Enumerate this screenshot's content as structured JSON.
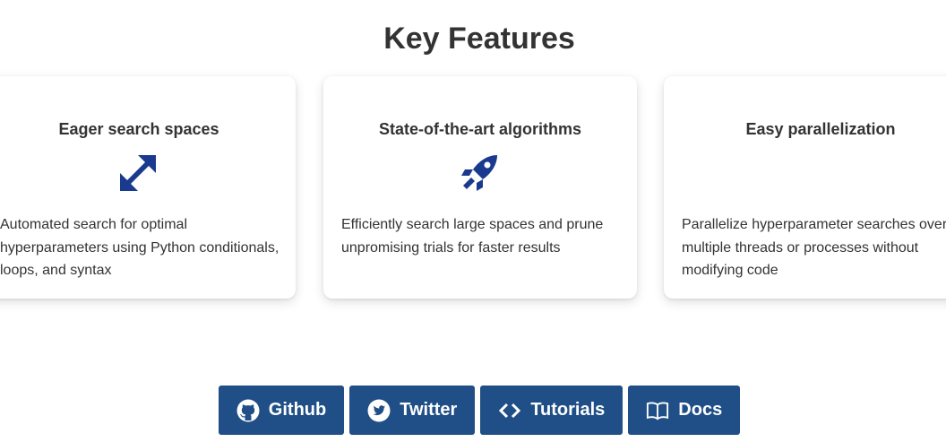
{
  "section": {
    "title": "Key Features"
  },
  "features": [
    {
      "title": "Eager search spaces",
      "icon": "expand-arrows-icon",
      "text": "Automated search for optimal hyperparameters using Python conditionals, loops, and syntax"
    },
    {
      "title": "State-of-the-art algorithms",
      "icon": "rocket-icon",
      "text": "Efficiently search large spaces and prune unpromising trials for faster results"
    },
    {
      "title": "Easy parallelization",
      "icon": "",
      "text": "Parallelize hyperparameter searches over multiple threads or processes without modifying code"
    }
  ],
  "buttons": [
    {
      "label": "Github",
      "icon": "github-icon"
    },
    {
      "label": "Twitter",
      "icon": "twitter-icon"
    },
    {
      "label": "Tutorials",
      "icon": "code-icon"
    },
    {
      "label": "Docs",
      "icon": "book-icon"
    }
  ],
  "colors": {
    "icon_blue": "#1a3a8f",
    "button_bg": "#1f4f86",
    "text": "#333333"
  }
}
